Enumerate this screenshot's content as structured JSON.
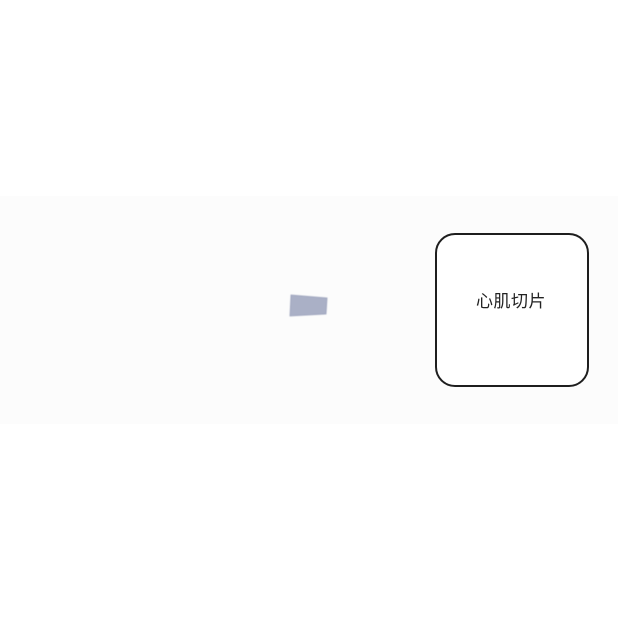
{
  "card": {
    "label": "心肌切片"
  },
  "colors": {
    "band_background": "#fcfcfc",
    "fragment_fill": "#aab0c6",
    "card_border": "#1e1e1e",
    "text": "#222222"
  },
  "icons": {
    "fragment": "tissue-slice-fragment"
  }
}
